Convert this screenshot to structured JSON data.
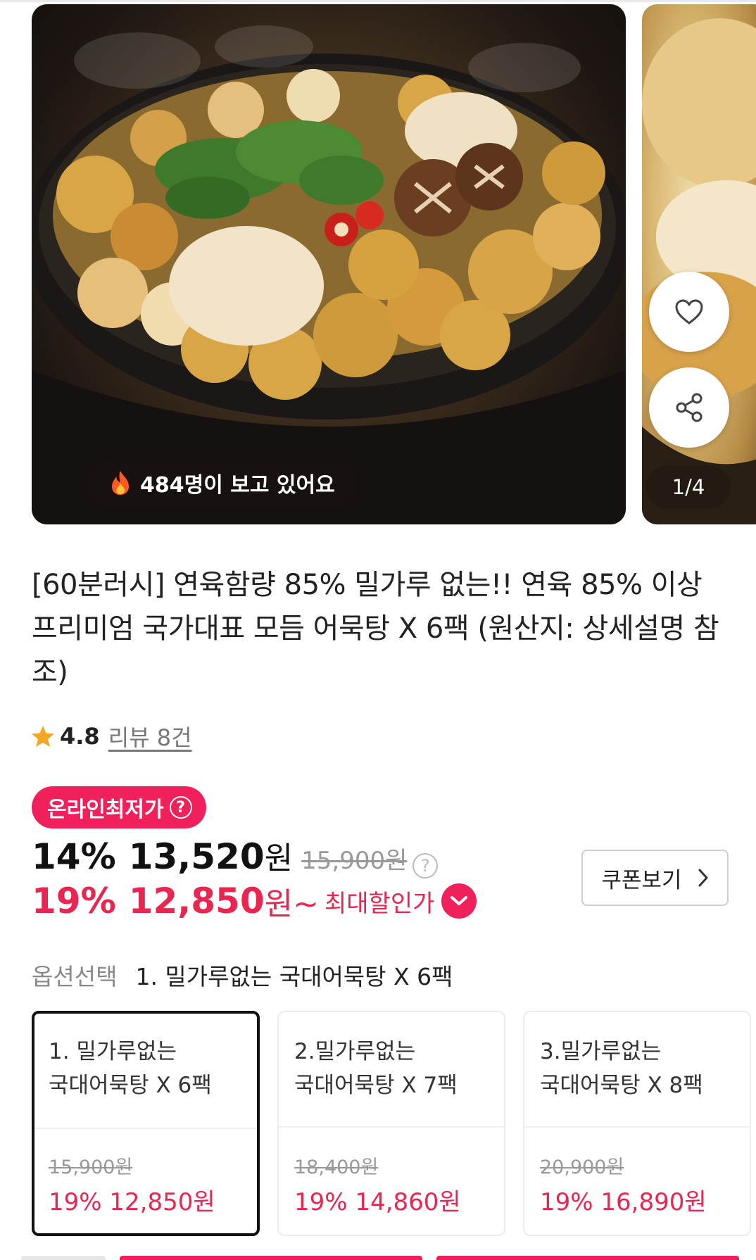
{
  "gallery": {
    "viewer_text": "484명이 보고 있어요",
    "page_counter": "1/4",
    "like_icon": "heart-icon",
    "share_icon": "share-icon"
  },
  "product": {
    "title": "[60분러시] 연육함량 85% 밀가루 없는!! 연육 85% 이상 프리미엄 국가대표 모듬 어묵탕 X 6팩 (원산지: 상세설명 참조)",
    "rating": "4.8",
    "reviews": "리뷰 8건"
  },
  "pricing": {
    "badge": "온라인최저가",
    "discount_pct": "14%",
    "price": "13,520",
    "currency": "원",
    "original_price": "15,900원",
    "max_discount_pct": "19%",
    "max_price": "12,850",
    "max_currency": "원~",
    "max_label": "최대할인가",
    "coupon_button": "쿠폰보기"
  },
  "options": {
    "label": "옵션선택",
    "selected": "1. 밀가루없는 국대어묵탕 X 6팩",
    "items": [
      {
        "line1": "1. 밀가루없는",
        "line2": "국대어묵탕 X 6팩",
        "original": "15,900원",
        "sale": "19% 12,850원"
      },
      {
        "line1": "2.밀가루없는",
        "line2": "국대어묵탕 X 7팩",
        "original": "18,400원",
        "sale": "19% 14,860원"
      },
      {
        "line1": "3.밀가루없는",
        "line2": "국대어묵탕 X 8팩",
        "original": "20,900원",
        "sale": "19% 16,890원"
      }
    ]
  },
  "colors": {
    "accent": "#e8264f",
    "badge": "#f0205b",
    "star": "#f5a623"
  }
}
